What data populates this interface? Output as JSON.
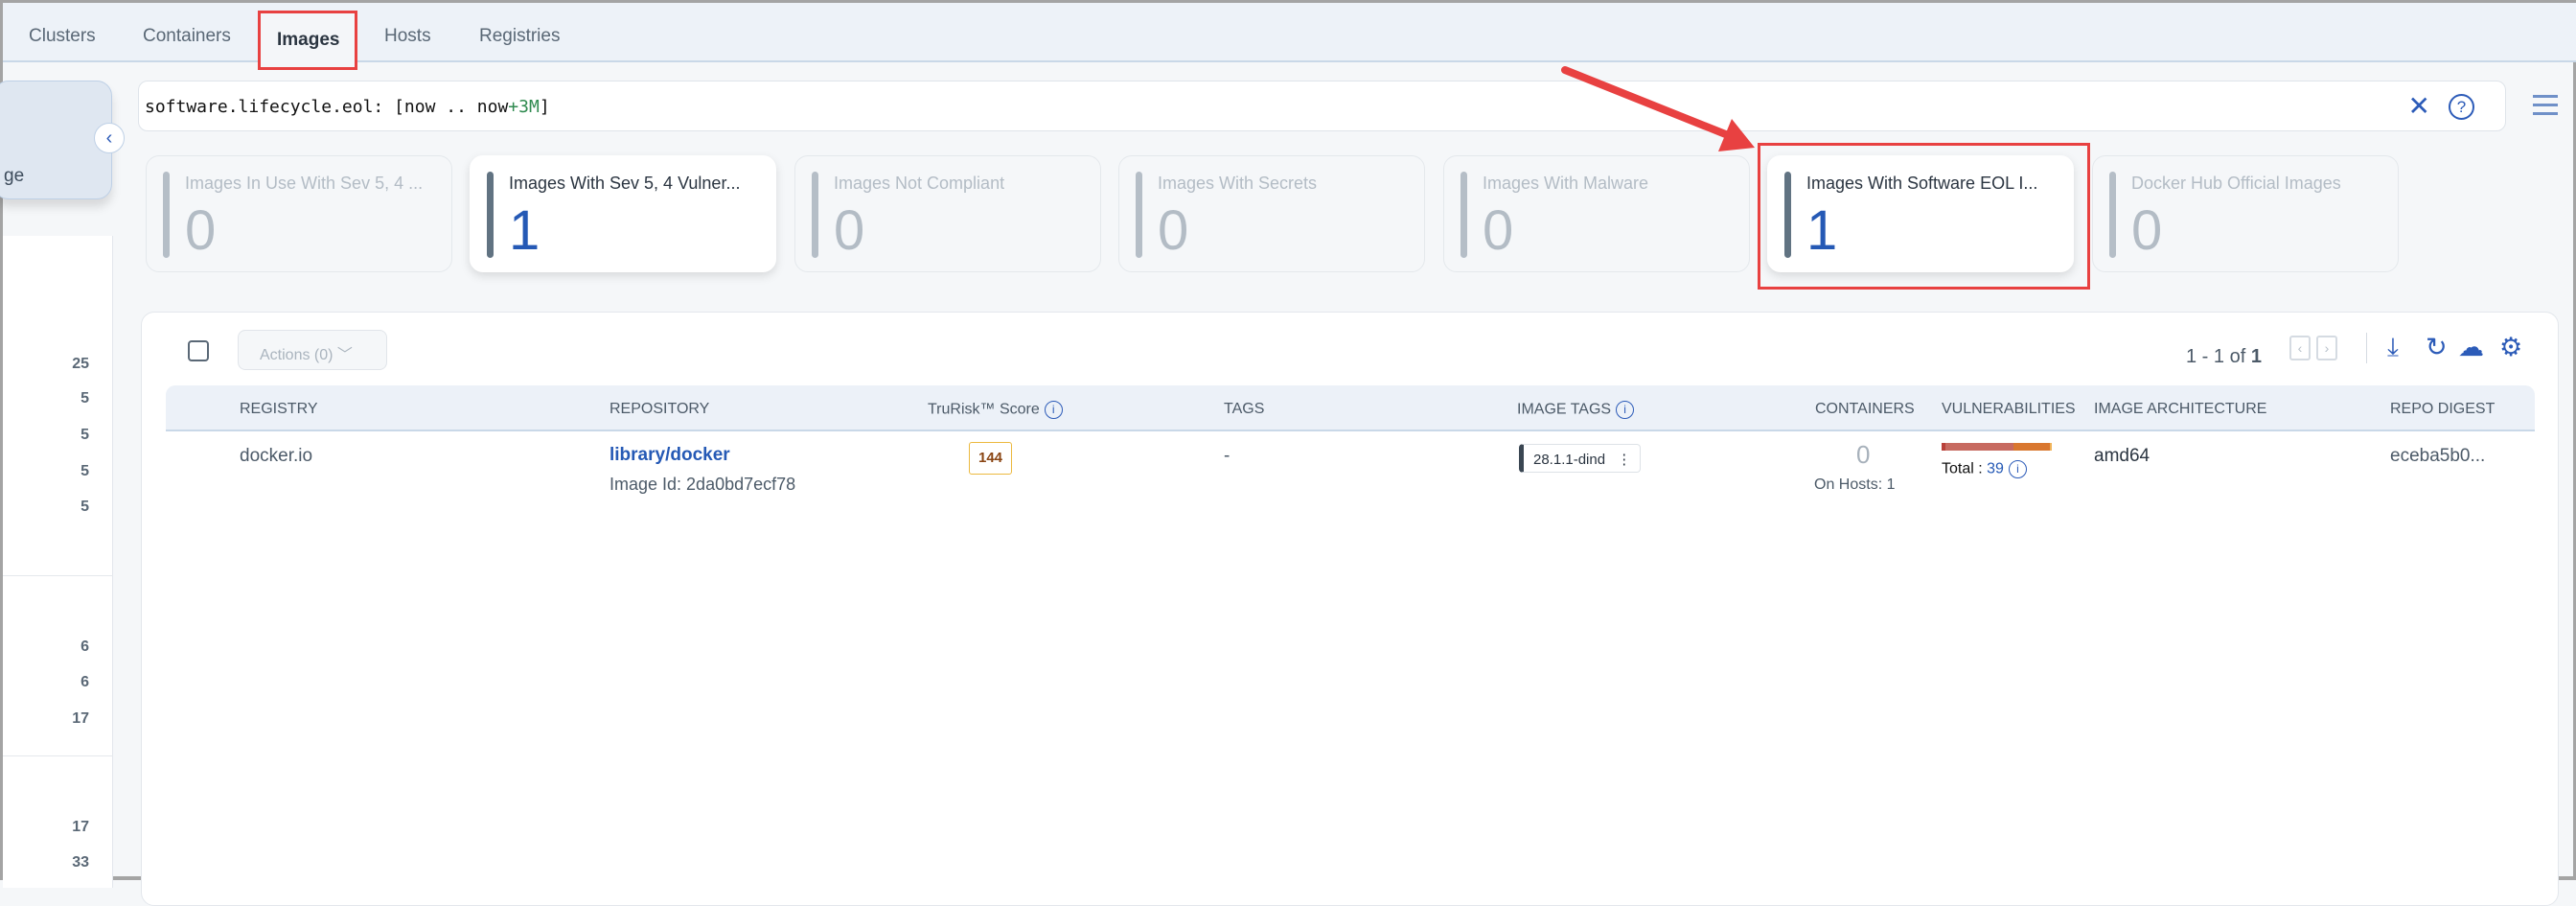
{
  "tabs": [
    "Clusters",
    "Containers",
    "Images",
    "Hosts",
    "Registries"
  ],
  "active_tab": "Images",
  "search": {
    "prefix": "software.lifecycle.eol: [now .. now",
    "highlight": "+3M",
    "suffix": "]",
    "clear_icon": "close-icon",
    "help_icon": "help-icon"
  },
  "left_panel": {
    "label_fragment": "ge",
    "counts": [
      "25",
      "5",
      "5",
      "5",
      "5",
      "6",
      "6",
      "17",
      "17",
      "33"
    ]
  },
  "cards": [
    {
      "title": "Images In Use With Sev 5, 4 ...",
      "value": "0"
    },
    {
      "title": "Images With Sev 5, 4 Vulner...",
      "value": "1"
    },
    {
      "title": "Images Not Compliant",
      "value": "0"
    },
    {
      "title": "Images With Secrets",
      "value": "0"
    },
    {
      "title": "Images With Malware",
      "value": "0"
    },
    {
      "title": "Images With Software EOL I...",
      "value": "1"
    },
    {
      "title": "Docker Hub Official Images",
      "value": "0"
    }
  ],
  "toolbar": {
    "actions_label": "Actions (0)",
    "pager_prefix": "1 - 1 of ",
    "pager_total": "1"
  },
  "table": {
    "headers": [
      "REGISTRY",
      "REPOSITORY",
      "TruRisk™ Score",
      "TAGS",
      "IMAGE TAGS",
      "CONTAINERS",
      "VULNERABILITIES",
      "IMAGE ARCHITECTURE",
      "REPO DIGEST"
    ],
    "rows": [
      {
        "registry": "docker.io",
        "repository": "library/docker",
        "image_id": "Image Id: 2da0bd7ecf78",
        "trurisk": "144",
        "tags": "-",
        "image_tag": "28.1.1-dind",
        "containers": "0",
        "on_hosts": "On Hosts: 1",
        "vuln_total_label": "Total : ",
        "vuln_total": "39",
        "architecture": "amd64",
        "repo_digest": "eceba5b0..."
      }
    ]
  },
  "colors": {
    "accent": "#2559b5",
    "highlight": "#e84141",
    "vuln_critical": "#b9413a",
    "vuln_high": "#c76a60",
    "vuln_medium": "#d9772f",
    "vuln_low": "#f0b35a"
  }
}
